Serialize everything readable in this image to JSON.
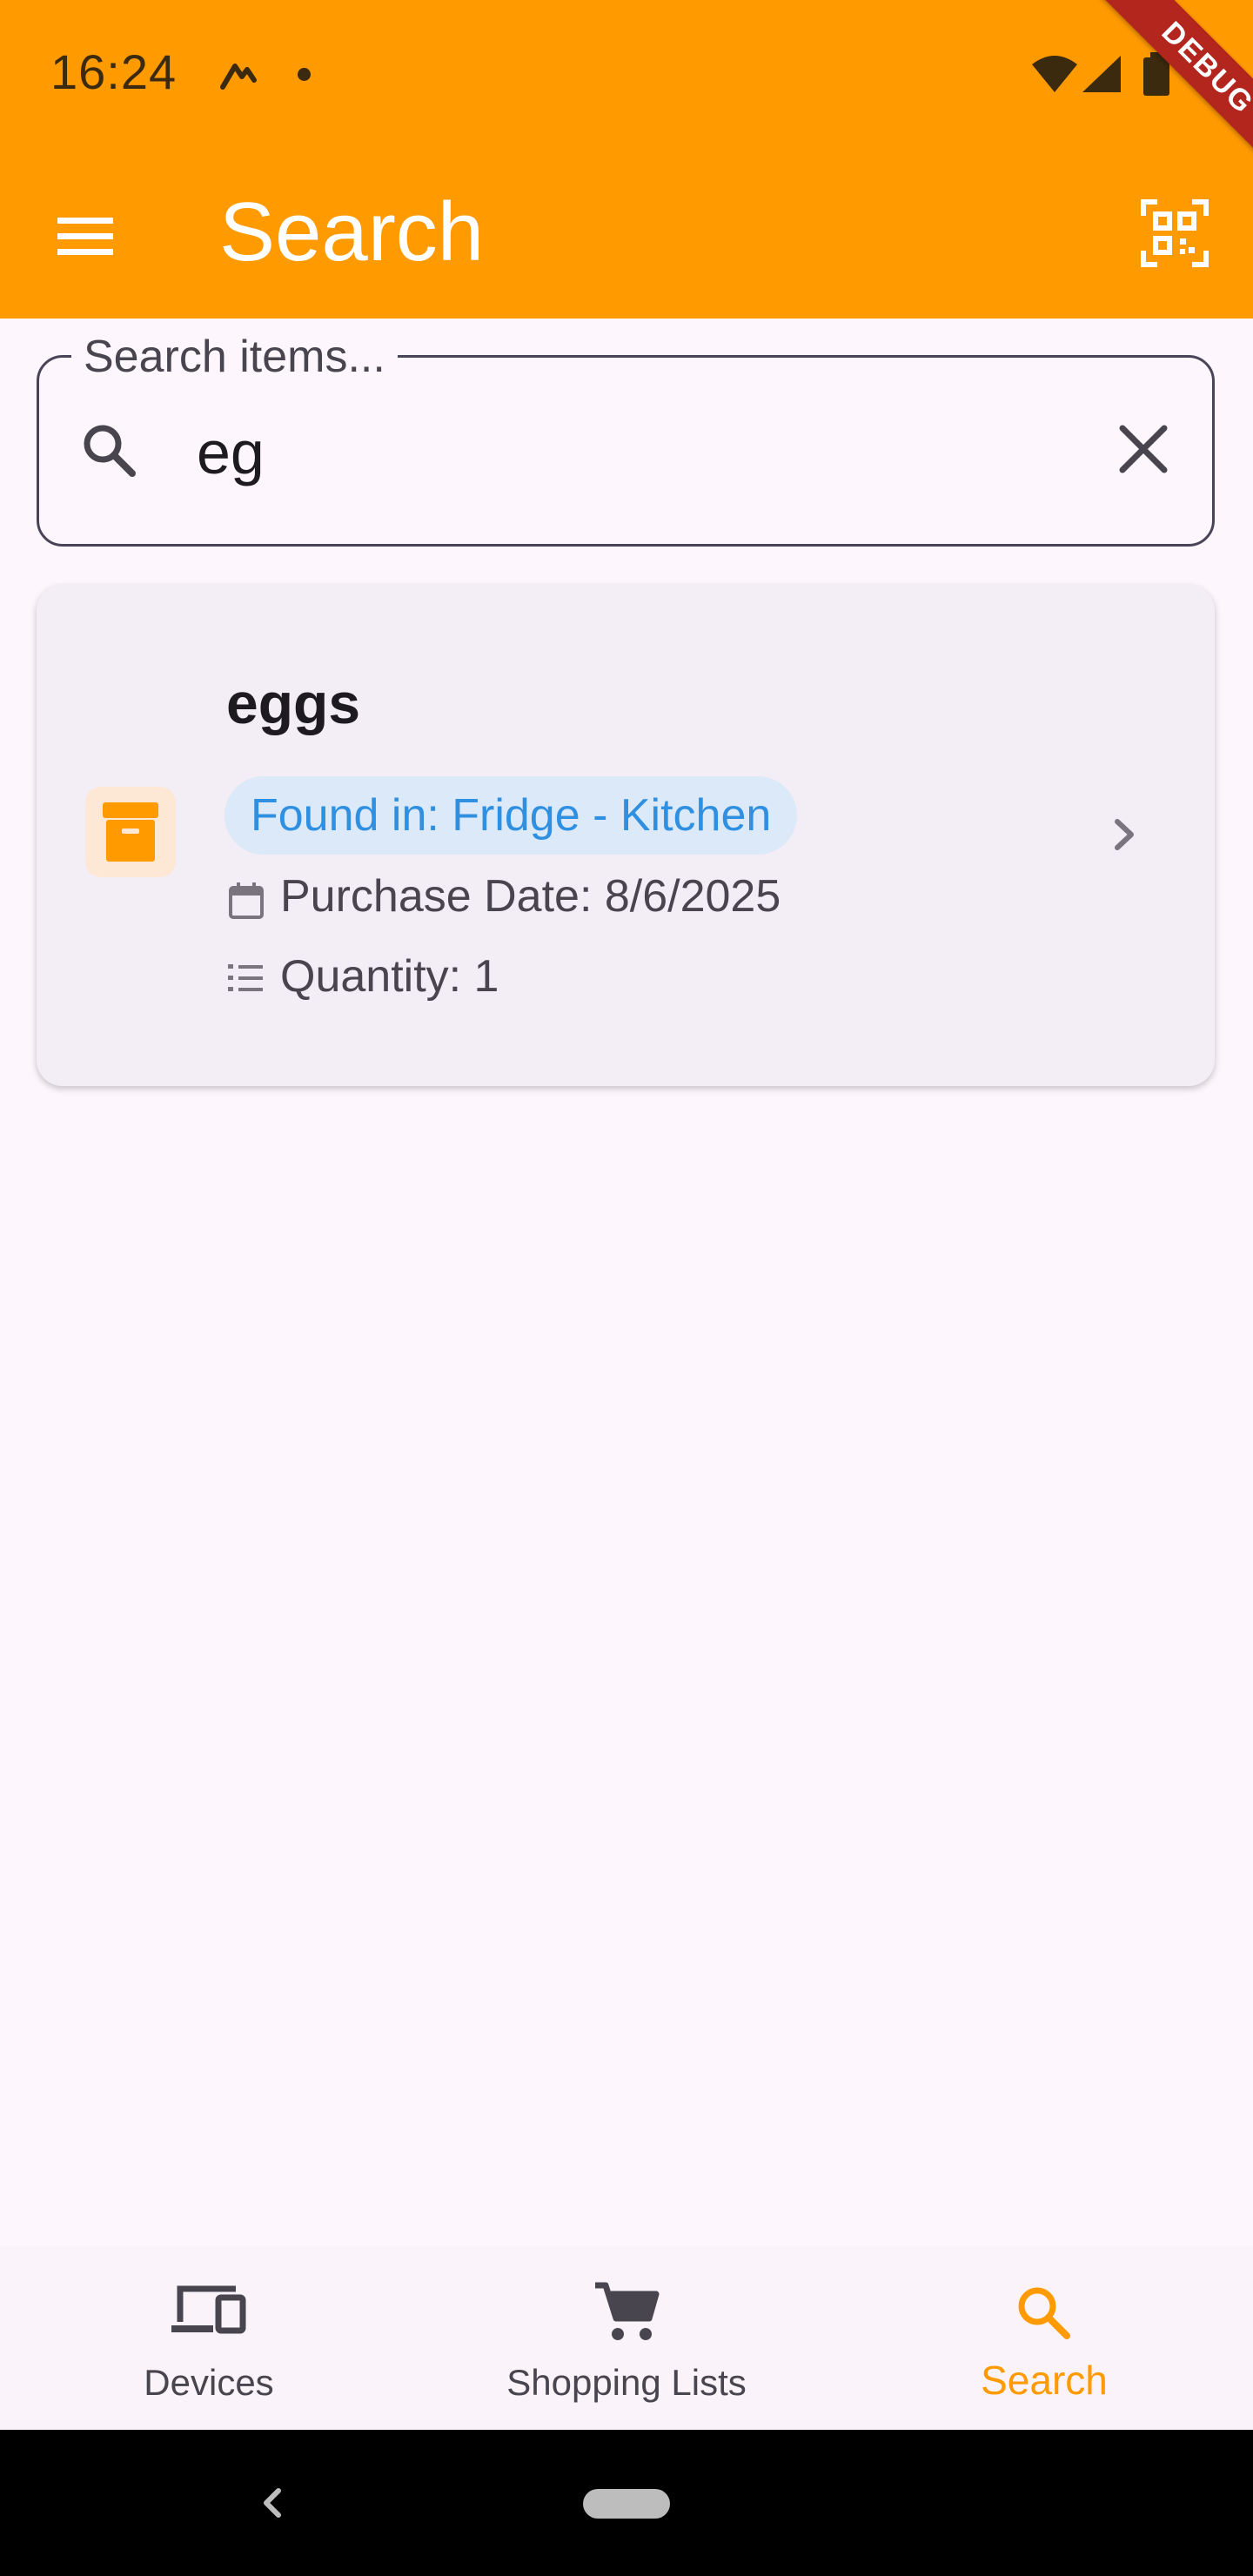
{
  "status_bar": {
    "time": "16:24"
  },
  "debug_banner": "DEBUG",
  "app_bar": {
    "title": "Search"
  },
  "search": {
    "label": "Search items...",
    "value": "eg"
  },
  "results": [
    {
      "name": "eggs",
      "location": "Found in: Fridge - Kitchen",
      "purchase_date": "Purchase Date: 8/6/2025",
      "quantity": "Quantity: 1"
    }
  ],
  "bottom_nav": {
    "items": [
      {
        "label": "Devices",
        "icon": "devices-icon"
      },
      {
        "label": "Shopping Lists",
        "icon": "shopping-cart-icon"
      },
      {
        "label": "Search",
        "icon": "search-icon"
      }
    ],
    "active": "Search"
  },
  "colors": {
    "primary": "#FF9A00",
    "background": "#FDF7FD",
    "card": "#F3EDF5",
    "chip_bg": "#DCE9F8",
    "chip_text": "#2F8FE0",
    "nav_inactive": "#49454F",
    "debug_banner": "#B3261E"
  }
}
